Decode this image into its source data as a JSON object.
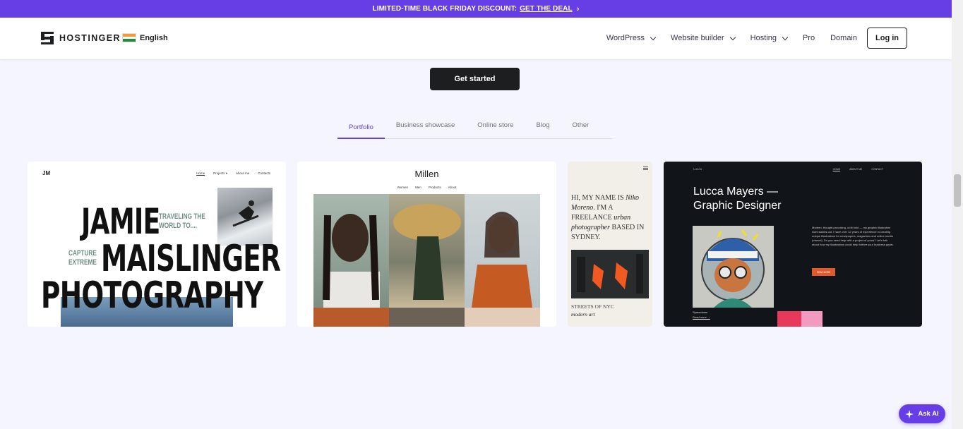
{
  "promo": {
    "text": "LIMITED-TIME BLACK FRIDAY DISCOUNT:",
    "link": "GET THE DEAL",
    "chevron": "›"
  },
  "header": {
    "logo": "HOSTINGER",
    "language": "English",
    "nav": [
      {
        "label": "WordPress"
      },
      {
        "label": "Website builder"
      },
      {
        "label": "Hosting"
      },
      {
        "label": "Pro"
      },
      {
        "label": "Domain"
      }
    ],
    "login": "Log in"
  },
  "cta": "Get started",
  "tabs": [
    "Portfolio",
    "Business showcase",
    "Online store",
    "Blog",
    "Other"
  ],
  "cards": {
    "jamie": {
      "monogram": "JM",
      "nav": [
        "Home",
        "Projects ▾",
        "About me",
        "Contacts"
      ],
      "line1": "JAMIE",
      "line2": "MAISLINGER",
      "line3": "PHOTOGRAPHY",
      "tag1": "TRAVELING THE WORLD TO....",
      "tag2": "CAPTURE EXTREME"
    },
    "millen": {
      "title": "Millen",
      "nav": [
        "Women",
        "Men",
        "Products",
        "About"
      ]
    },
    "niko": {
      "intro_a": "HI, MY NAME IS",
      "intro_b": "Niko Moreno",
      "intro_c": ". I'M A FREELANCE",
      "intro_d": "urban photographer",
      "intro_e": "BASED IN SYDNEY.",
      "caption_a": "STREETS OF NYC",
      "caption_b": "modern art"
    },
    "lucca": {
      "logo": "Lucca",
      "nav": [
        "HOME",
        "ABOUT ME",
        "CONTACT"
      ],
      "heading_1": "Lucca Mayers —",
      "heading_2": "Graphic Designer",
      "body": "Modern, thought-provoking, a bit bold — my graphic illustration work stands out. I have over 12 years of experience in creating unique illustrations for newspapers, magazines and online media (marvel). Do you need help with a project of yours? Let's talk about how my illustrations could help further your business goals.",
      "button": "READ MORE",
      "sub": "Spacedome",
      "readmore": "Read more →"
    }
  },
  "ask_ai": "Ask AI",
  "colors": {
    "brand": "#673de6",
    "dark": "#1d1e20",
    "background": "#f4f5ff",
    "accent_orange": "#e25a2b"
  },
  "icons": [
    "hostinger-logo-icon",
    "india-flag-icon",
    "chevron-down-icon",
    "sparkle-icon",
    "menu-icon"
  ]
}
